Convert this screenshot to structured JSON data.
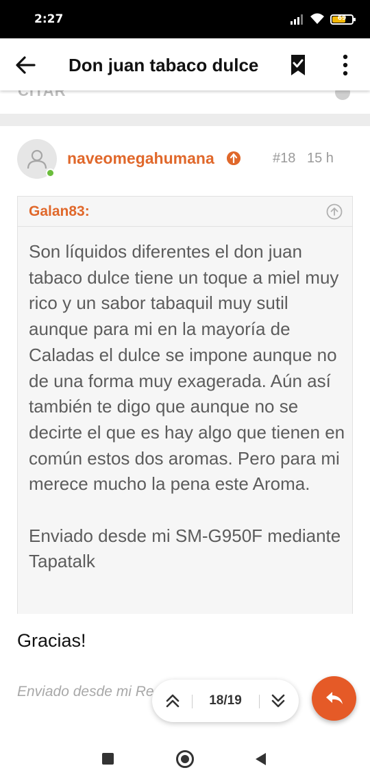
{
  "status_bar": {
    "time": "2:27",
    "battery_text": "69",
    "battery_level_percent": 69,
    "battery_color": "#f2b705"
  },
  "toolbar": {
    "title": "Don juan tabaco dulce",
    "back_icon": "arrow-left",
    "bookmark_icon": "bookmark-check",
    "more_icon": "dots-vertical"
  },
  "previous_post": {
    "quote_label": "CITAR"
  },
  "post": {
    "username": "naveomegahumana",
    "post_number": "#18",
    "time_ago": "15 h",
    "online": true,
    "quote": {
      "author": "Galan83:",
      "text": "Son líquidos diferentes el don juan tabaco dulce tiene un toque a miel muy rico y un sabor tabaquil muy sutil aunque para mi en la mayoría de Caladas el dulce se impone aunque no de una forma muy exagerada. Aún así también te digo que aunque no se decirte el que es hay algo que tienen en común estos dos aromas. Pero para mi merece mucho la pena este Aroma.\n\nEnviado desde mi SM-G950F mediante Tapatalk"
    },
    "body": "Gracias!",
    "signature": "Enviado desde mi Re           Jian Tapatalk"
  },
  "pager": {
    "pages": "18/19"
  },
  "colors": {
    "accent": "#e0682b",
    "fab": "#e55a27",
    "online": "#6bbd3c"
  }
}
